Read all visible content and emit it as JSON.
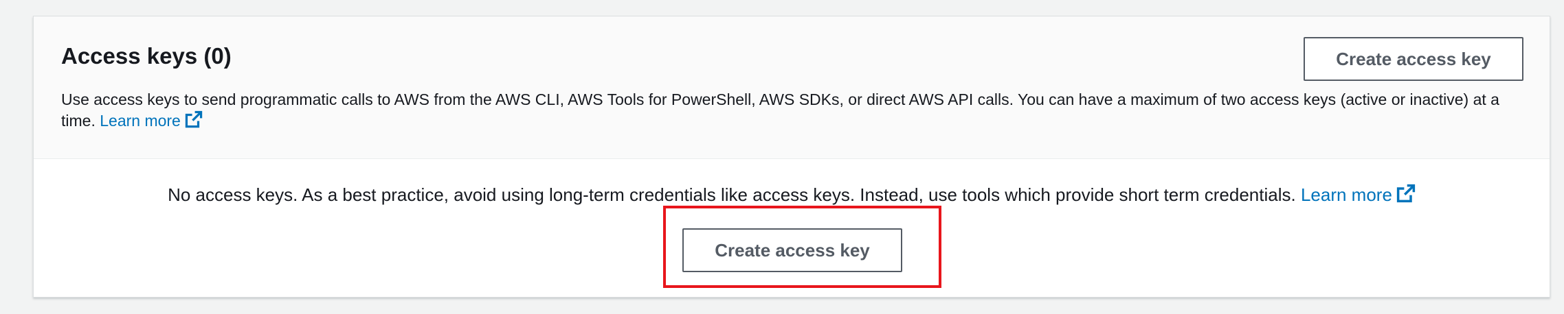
{
  "access_keys": {
    "title": "Access keys (0)",
    "create_button_label": "Create access key",
    "description": "Use access keys to send programmatic calls to AWS from the AWS CLI, AWS Tools for PowerShell, AWS SDKs, or direct AWS API calls. You can have a maximum of two access keys (active or inactive) at a time.",
    "learn_more_label": "Learn more",
    "empty_message": "No access keys. As a best practice, avoid using long-term credentials like access keys. Instead, use tools which provide short term credentials.",
    "empty_learn_more_label": "Learn more",
    "empty_create_button_label": "Create access key"
  },
  "icons": {
    "external_link": "external-link-icon"
  },
  "colors": {
    "link": "#0073bb",
    "highlight": "#e8161c",
    "button_border": "#545b64",
    "text": "#16191f"
  }
}
